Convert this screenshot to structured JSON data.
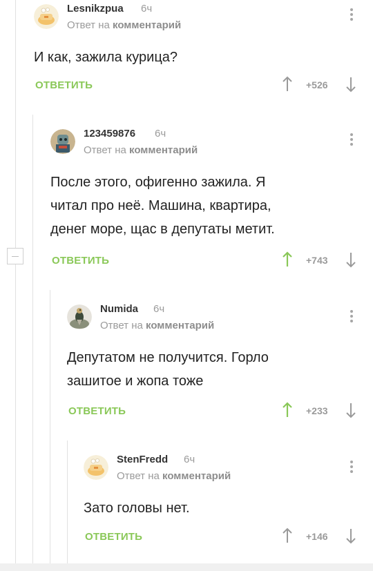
{
  "comments": [
    {
      "username": "Lesnikzpua",
      "time": "6ч",
      "sub_prefix": "Ответ на",
      "sub_link": "комментарий",
      "lines": [
        "И как, зажила курица?"
      ],
      "reply_label": "ОТВЕТИТЬ",
      "score": "+526",
      "upvoted": false,
      "avatar": "chicken-avatar"
    },
    {
      "username": "123459876",
      "time": "6ч",
      "sub_prefix": "Ответ на",
      "sub_link": "комментарий",
      "lines": [
        "После этого, офигенно зажила. Я",
        "читал про неё. Машина, квартира,",
        "денег море, щас в депутаты метит."
      ],
      "reply_label": "ОТВЕТИТЬ",
      "score": "+743",
      "upvoted": true,
      "avatar": "character-avatar"
    },
    {
      "username": "Numida",
      "time": "6ч",
      "sub_prefix": "Ответ на",
      "sub_link": "комментарий",
      "lines": [
        "Депутатом не получится. Горло",
        "зашитое и жопа тоже"
      ],
      "reply_label": "ОТВЕТИТЬ",
      "score": "+233",
      "upvoted": true,
      "avatar": "bird-avatar"
    },
    {
      "username": "StenFredd",
      "time": "6ч",
      "sub_prefix": "Ответ на",
      "sub_link": "комментарий",
      "lines": [
        "Зато головы нет."
      ],
      "reply_label": "ОТВЕТИТЬ",
      "score": "+146",
      "upvoted": false,
      "avatar": "chicken-avatar"
    }
  ],
  "colors": {
    "accent": "#8ac858",
    "muted": "#9a9a9a",
    "text": "#222222"
  }
}
